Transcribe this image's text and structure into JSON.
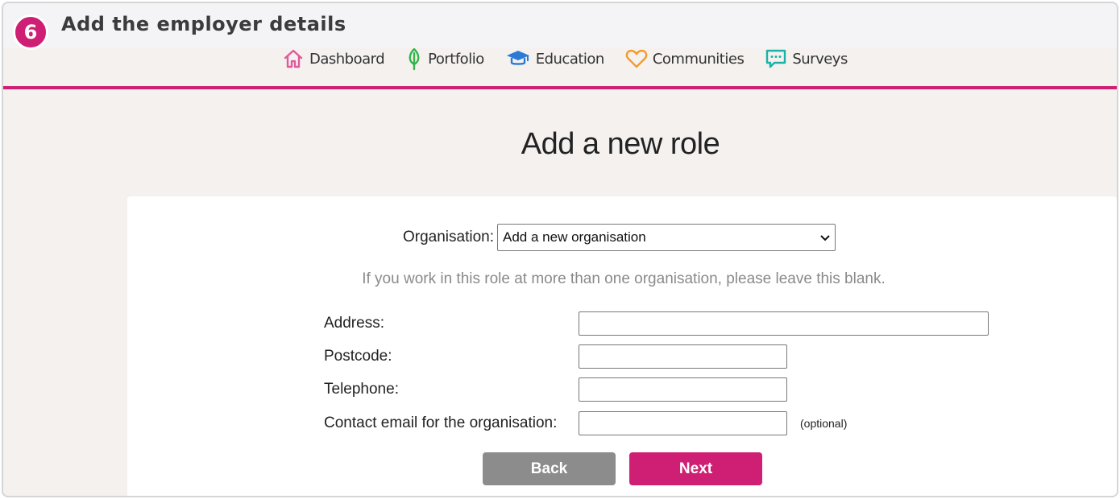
{
  "step": {
    "number": "6",
    "title": "Add the employer details"
  },
  "nav": {
    "items": [
      {
        "label": "Dashboard",
        "icon": "home-icon",
        "color": "#e05a9c"
      },
      {
        "label": "Portfolio",
        "icon": "leaf-icon",
        "color": "#34b44a"
      },
      {
        "label": "Education",
        "icon": "graduation-cap-icon",
        "color": "#2b7bd6"
      },
      {
        "label": "Communities",
        "icon": "heart-icon",
        "color": "#f39c2b"
      },
      {
        "label": "Surveys",
        "icon": "chat-bubble-icon",
        "color": "#1bb3a6"
      }
    ]
  },
  "page": {
    "title": "Add a new role"
  },
  "form": {
    "organisation_label": "Organisation:",
    "organisation_selected": "Add a new organisation",
    "hint": "If you work in this role at more than one organisation, please leave this blank.",
    "address_label": "Address:",
    "address_value": "",
    "postcode_label": "Postcode:",
    "postcode_value": "",
    "telephone_label": "Telephone:",
    "telephone_value": "",
    "email_label": "Contact email for the organisation:",
    "email_value": "",
    "optional_note": "(optional)",
    "back_label": "Back",
    "next_label": "Next"
  },
  "colors": {
    "accent": "#cf1f74",
    "back_button": "#8c8c8c",
    "background": "#f4f1ef"
  }
}
